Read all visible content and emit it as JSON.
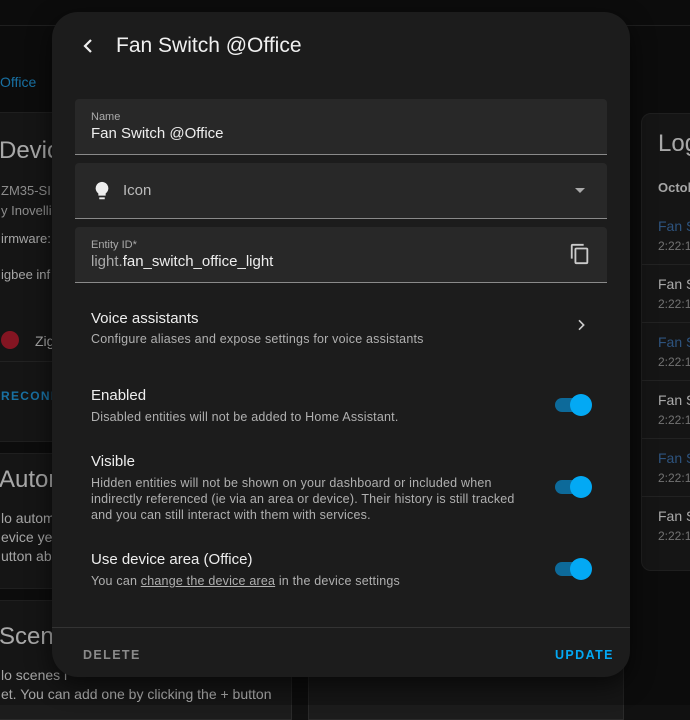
{
  "background": {
    "breadcrumb_link": "Office",
    "device_card": {
      "title": "Device",
      "model": "ZM35-SI",
      "manufacturer": "y Inovelli",
      "firmware": "irmware:",
      "zigbee_info": "igbee inf",
      "integration": "Zig",
      "reconfigure": "RECONF"
    },
    "automations_card": {
      "title": "Auton",
      "lines": [
        "lo autom",
        "evice yet",
        "utton ab"
      ]
    },
    "scenes_card": {
      "title": "Scene",
      "lines": [
        "lo scenes i",
        "et. You can add one by clicking the + button"
      ]
    },
    "logbook_card": {
      "title": "Log",
      "date": "Octol",
      "items": [
        {
          "name": "Fan S",
          "time": "2:22:1",
          "link": true
        },
        {
          "name": "Fan S",
          "time": "2:22:1",
          "link": false
        },
        {
          "name": "Fan S",
          "time": "2:22:1",
          "link": true
        },
        {
          "name": "Fan S",
          "time": "2:22:1",
          "link": false
        },
        {
          "name": "Fan S",
          "time": "2:22:1",
          "link": true
        },
        {
          "name": "Fan S",
          "time": "2:22:1",
          "link": false
        }
      ]
    }
  },
  "dialog": {
    "title": "Fan Switch @Office",
    "name_field": {
      "label": "Name",
      "value": "Fan Switch @Office"
    },
    "icon_field": {
      "placeholder": "Icon",
      "icon": "lightbulb-icon"
    },
    "entity_id_field": {
      "label": "Entity ID*",
      "prefix": "light.",
      "value": "fan_switch_office_light"
    },
    "voice_assistants": {
      "title": "Voice assistants",
      "description": "Configure aliases and expose settings for voice assistants"
    },
    "enabled": {
      "title": "Enabled",
      "description": "Disabled entities will not be added to Home Assistant.",
      "on": true
    },
    "visible": {
      "title": "Visible",
      "description": "Hidden entities will not be shown on your dashboard or included when indirectly referenced (ie via an area or device). Their history is still tracked and you can still interact with them with services.",
      "on": true
    },
    "use_device_area": {
      "title": "Use device area (Office)",
      "desc_before": "You can ",
      "desc_link": "change the device area",
      "desc_after": " in the device settings",
      "on": true
    },
    "delete_label": "DELETE",
    "update_label": "UPDATE"
  },
  "colors": {
    "accent": "#03a9f4",
    "link": "#2196d9",
    "surface": "#1c1c1c",
    "background": "#111111"
  }
}
